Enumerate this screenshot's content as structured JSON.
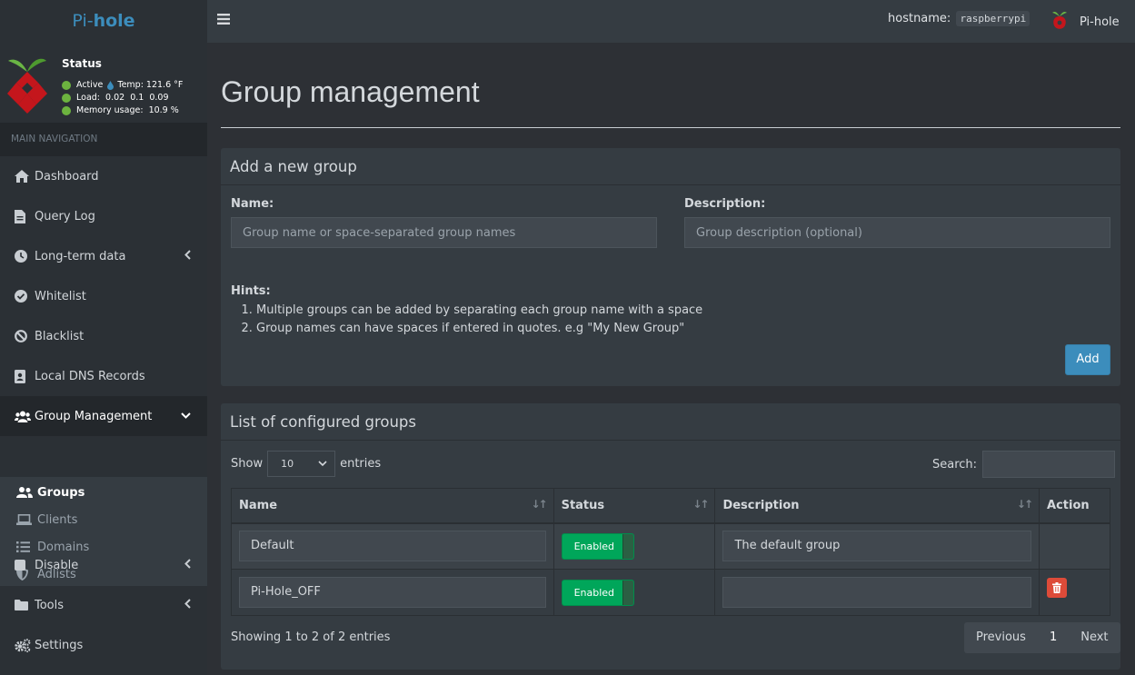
{
  "topbar": {
    "logo_prefix": "Pi-",
    "logo_strong": "hole",
    "hostname_label": "hostname:",
    "hostname_value": "raspberrypi",
    "user_label": "Pi-hole"
  },
  "status": {
    "title": "Status",
    "active": "Active",
    "temp": "Temp: 121.6 °F",
    "load": "Load:  0.02  0.1  0.09",
    "memory": "Memory usage:  10.9 %"
  },
  "nav": {
    "header": "MAIN NAVIGATION",
    "items": [
      {
        "label": "Dashboard",
        "icon": "home-icon"
      },
      {
        "label": "Query Log",
        "icon": "file-icon"
      },
      {
        "label": "Long-term data",
        "icon": "clock-icon"
      },
      {
        "label": "Whitelist",
        "icon": "check-circle-icon"
      },
      {
        "label": "Blacklist",
        "icon": "ban-icon"
      },
      {
        "label": "Local DNS Records",
        "icon": "address-book-icon"
      },
      {
        "label": "Group Management",
        "icon": "users-icon"
      },
      {
        "label": "Disable",
        "icon": "stop-icon"
      },
      {
        "label": "Tools",
        "icon": "folder-icon"
      },
      {
        "label": "Settings",
        "icon": "cogs-icon"
      }
    ],
    "sub_items": [
      {
        "label": "Groups",
        "icon": "user-friends-icon"
      },
      {
        "label": "Clients",
        "icon": "laptop-icon"
      },
      {
        "label": "Domains",
        "icon": "list-icon"
      },
      {
        "label": "Adlists",
        "icon": "shield-icon"
      }
    ]
  },
  "page": {
    "title": "Group management"
  },
  "add_group": {
    "header": "Add a new group",
    "name_label": "Name:",
    "name_placeholder": "Group name or space-separated group names",
    "desc_label": "Description:",
    "desc_placeholder": "Group description (optional)",
    "hints_title": "Hints:",
    "hints": [
      "Multiple groups can be added by separating each group name with a space",
      "Group names can have spaces if entered in quotes. e.g \"My New Group\""
    ],
    "add_button": "Add"
  },
  "group_list": {
    "header": "List of configured groups",
    "show_label": "Show",
    "page_length": "10",
    "entries_label": "entries",
    "search_label": "Search:",
    "columns": [
      "Name",
      "Status",
      "Description",
      "Action"
    ],
    "rows": [
      {
        "name": "Default",
        "status": "Enabled",
        "description": "The default group"
      },
      {
        "name": "Pi-Hole_OFF",
        "status": "Enabled",
        "description": ""
      }
    ],
    "info": "Showing 1 to 2 of 2 entries",
    "pager": {
      "previous": "Previous",
      "current": "1",
      "next": "Next"
    }
  },
  "colors": {
    "accent": "#3c8dbc",
    "enabled": "#00a65a",
    "danger": "#dd4b39",
    "status_dot": "#6cb33f"
  }
}
